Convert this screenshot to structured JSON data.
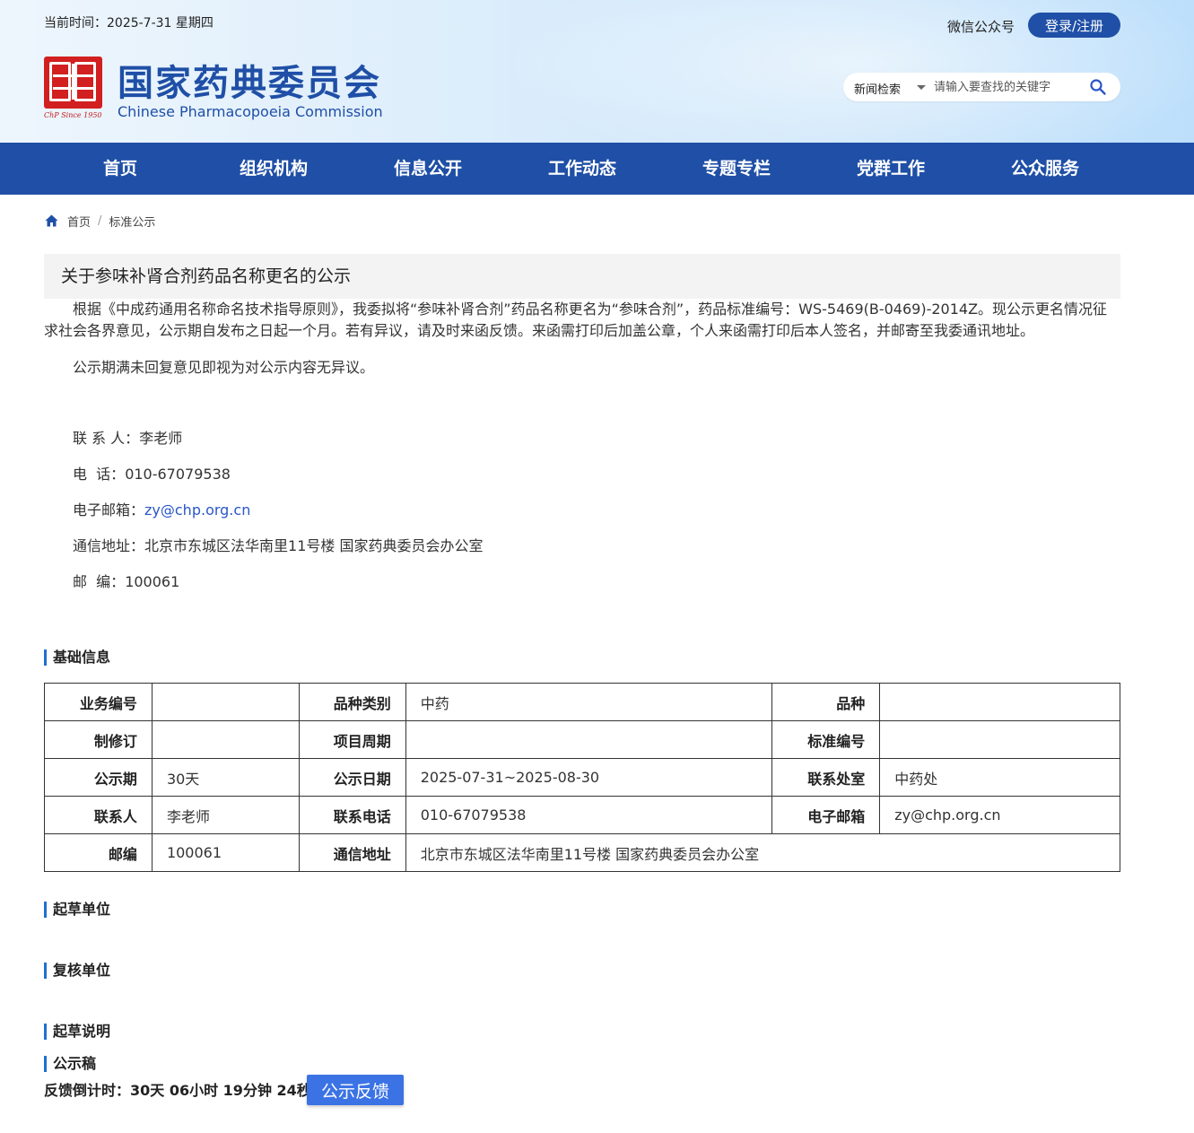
{
  "header": {
    "date_line": "当前时间：2025-7-31 星期四",
    "wechat_label": "微信公众号",
    "login_label": "登录/注册",
    "logo_title": "国家药典委员会",
    "logo_subtitle": "Chinese Pharmacopoeia Commission",
    "logo_since": "ChP Since 1950",
    "search": {
      "category": "新闻检索",
      "placeholder": "请输入要查找的关键字",
      "value": ""
    }
  },
  "nav": {
    "items": [
      {
        "label": "首页"
      },
      {
        "label": "组织机构"
      },
      {
        "label": "信息公开"
      },
      {
        "label": "工作动态"
      },
      {
        "label": "专题专栏"
      },
      {
        "label": "党群工作"
      },
      {
        "label": "公众服务"
      }
    ]
  },
  "breadcrumb": {
    "home": "首页",
    "separator": "/",
    "current": "标准公示"
  },
  "article": {
    "title": "关于参味补肾合剂药品名称更名的公示",
    "paragraph1": "根据《中成药通用名称命名技术指导原则》，我委拟将“参味补肾合剂”药品名称更名为“参味合剂”，药品标准编号：WS-5469(B-0469)-2014Z。现公示更名情况征求社会各界意见，公示期自发布之日起一个月。若有异议，请及时来函反馈。来函需打印后加盖公章，个人来函需打印后本人签名，并邮寄至我委通讯地址。",
    "paragraph2": "公示期满未回复意见即视为对公示内容无异议。",
    "contact": {
      "person_label": "联 系 人：",
      "person": "李老师",
      "phone_label": "电  话：",
      "phone": "010-67079538",
      "email_label": "电子邮箱：",
      "email": "zy@chp.org.cn",
      "address_label": "通信地址：",
      "address": "北京市东城区法华南里11号楼 国家药典委员会办公室",
      "zip_label": "邮  编：",
      "zip": "100061"
    }
  },
  "sections": {
    "basic_info": "基础信息",
    "drafting_unit": "起草单位",
    "review_unit": "复核单位",
    "drafting_notes": "起草说明",
    "public_draft": "公示稿"
  },
  "info_table": {
    "rows": [
      [
        {
          "label": "业务编号",
          "value": ""
        },
        {
          "label": "品种类别",
          "value": "中药"
        },
        {
          "label": "品种",
          "value": ""
        }
      ],
      [
        {
          "label": "制修订",
          "value": ""
        },
        {
          "label": "项目周期",
          "value": ""
        },
        {
          "label": "标准编号",
          "value": ""
        }
      ],
      [
        {
          "label": "公示期",
          "value": "30天"
        },
        {
          "label": "公示日期",
          "value": "2025-07-31~2025-08-30"
        },
        {
          "label": "联系处室",
          "value": "中药处"
        }
      ],
      [
        {
          "label": "联系人",
          "value": "李老师"
        },
        {
          "label": "联系电话",
          "value": "010-67079538"
        },
        {
          "label": "电子邮箱",
          "value": "zy@chp.org.cn"
        }
      ],
      [
        {
          "label": "邮编",
          "value": "100061"
        },
        {
          "label": "通信地址",
          "value": "北京市东城区法华南里11号楼 国家药典委员会办公室"
        }
      ]
    ]
  },
  "countdown": {
    "text": "反馈倒计时：30天 06小时 19分钟 24秒",
    "button_label": "公示反馈"
  },
  "colors": {
    "brand_blue": "#1f4fa6",
    "section_accent": "#1f6fd1",
    "button_blue": "#3b73e5",
    "seal_red": "#d21f1f",
    "link_blue": "#2a56c6"
  }
}
